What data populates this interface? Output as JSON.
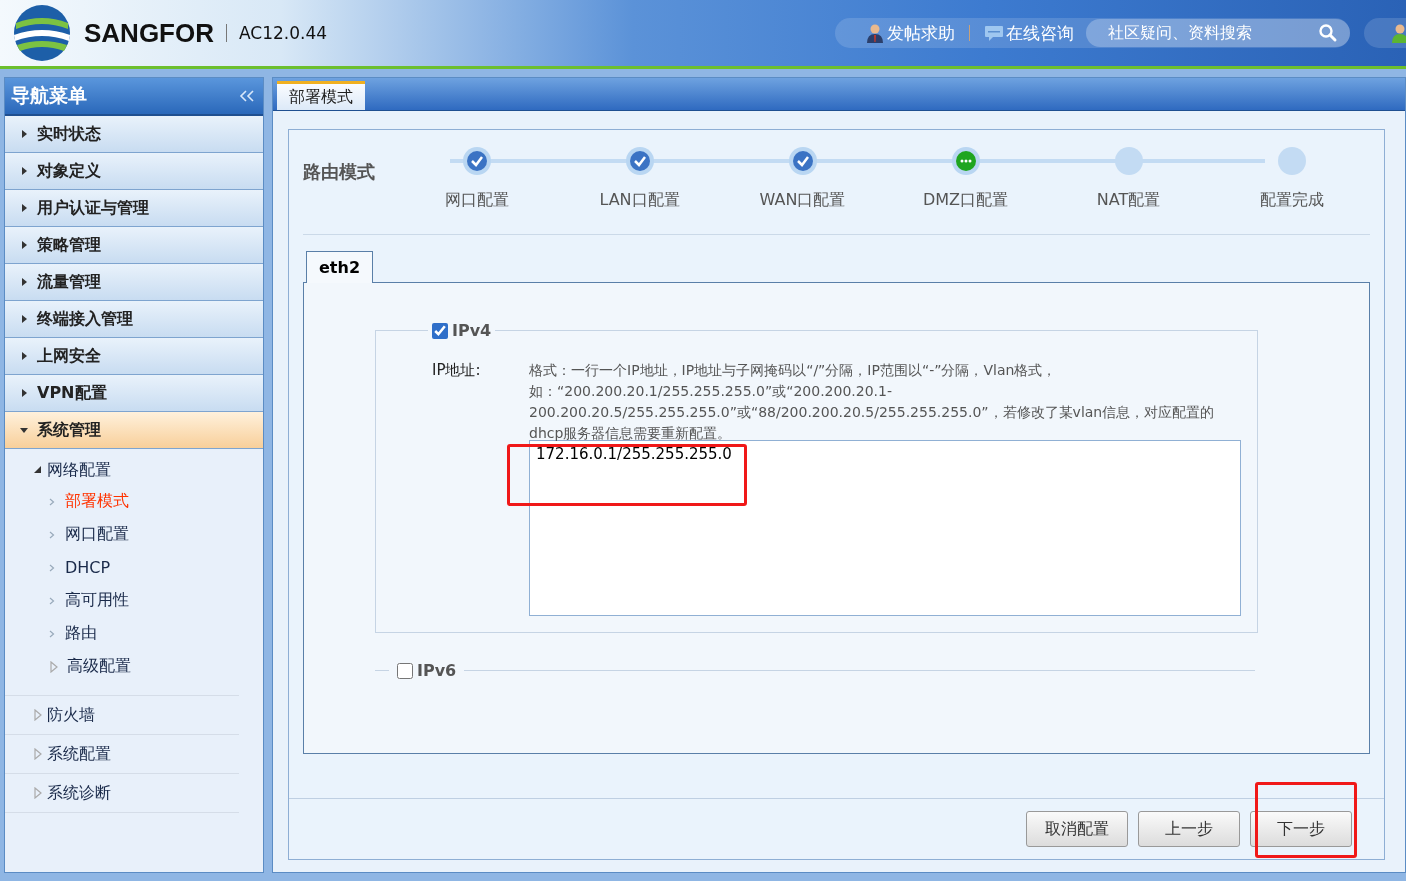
{
  "header": {
    "brand": "SANGFOR",
    "version": "AC12.0.44",
    "links": [
      {
        "label": "发帖求助",
        "kind": "person"
      },
      {
        "label": "在线咨询",
        "kind": "chat"
      }
    ],
    "search": {
      "placeholder": "社区疑问、资料搜索"
    }
  },
  "nav": {
    "title": "导航菜单",
    "items": [
      {
        "label": "实时状态",
        "expanded": false
      },
      {
        "label": "对象定义",
        "expanded": false
      },
      {
        "label": "用户认证与管理",
        "expanded": false
      },
      {
        "label": "策略管理",
        "expanded": false
      },
      {
        "label": "流量管理",
        "expanded": false
      },
      {
        "label": "终端接入管理",
        "expanded": false
      },
      {
        "label": "上网安全",
        "expanded": false
      },
      {
        "label": "VPN配置",
        "expanded": false
      },
      {
        "label": "系统管理",
        "expanded": true,
        "children": [
          {
            "label": "网络配置",
            "expanded": true,
            "children": [
              {
                "label": "部署模式",
                "kind": "page",
                "selected": true
              },
              {
                "label": "网口配置",
                "kind": "page",
                "selected": false
              },
              {
                "label": "DHCP",
                "kind": "page",
                "selected": false
              },
              {
                "label": "高可用性",
                "kind": "page",
                "selected": false
              },
              {
                "label": "路由",
                "kind": "page",
                "selected": false
              },
              {
                "label": "高级配置",
                "kind": "folder",
                "expanded": false
              }
            ]
          },
          {
            "label": "防火墙",
            "expanded": false
          },
          {
            "label": "系统配置",
            "expanded": false
          },
          {
            "label": "系统诊断",
            "expanded": false
          }
        ]
      }
    ]
  },
  "tabs": [
    {
      "label": "部署模式",
      "selected": true
    }
  ],
  "wizard": {
    "mode": "路由模式",
    "steps": [
      {
        "label": "网口配置",
        "completed": true,
        "current": false
      },
      {
        "label": "LAN口配置",
        "completed": true,
        "current": false
      },
      {
        "label": "WAN口配置",
        "completed": true,
        "current": false
      },
      {
        "label": "DMZ口配置",
        "completed": false,
        "current": true
      },
      {
        "label": "NAT配置",
        "completed": false,
        "current": false
      },
      {
        "label": "配置完成",
        "completed": false,
        "current": false
      }
    ]
  },
  "interface_tabs": [
    {
      "label": "eth2",
      "selected": true
    }
  ],
  "ipv4": {
    "label": "IPv4",
    "checked": true,
    "field_label": "IP地址:",
    "hint": "格式：一行一个IP地址，IP地址与子网掩码以“/”分隔，IP范围以“-”分隔，Vlan格式，如：“200.200.20.1/255.255.255.0”或“200.200.20.1-200.200.20.5/255.255.255.0”或“88/200.200.20.5/255.255.255.0”，若修改了某vlan信息，对应配置的dhcp服务器信息需要重新配置。",
    "value": "172.16.0.1/255.255.255.0"
  },
  "ipv6": {
    "label": "IPv6",
    "checked": false
  },
  "buttons": [
    {
      "label": "取消配置"
    },
    {
      "label": "上一步"
    },
    {
      "label": "下一步"
    }
  ]
}
